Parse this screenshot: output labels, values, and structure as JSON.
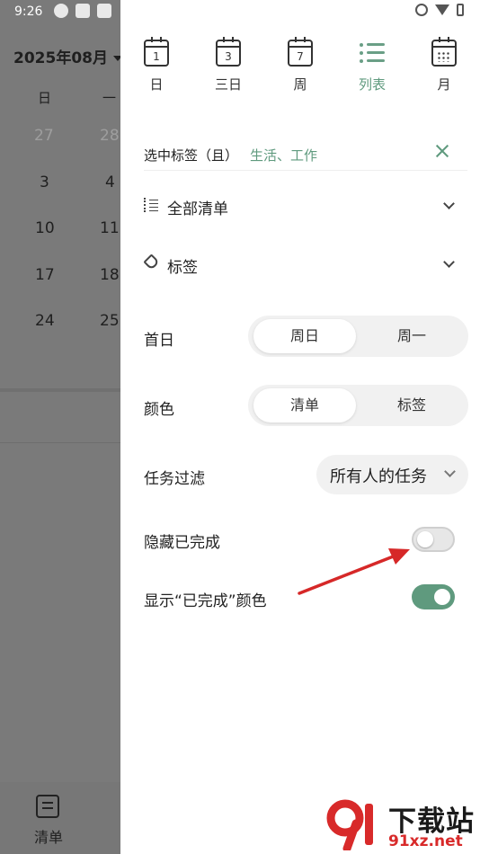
{
  "status_bar": {
    "time": "9:26"
  },
  "background_calendar": {
    "month_title": "2025年08月",
    "weekdays": [
      "日",
      "一"
    ],
    "rows": [
      [
        "27",
        "28"
      ],
      [
        "3",
        "4"
      ],
      [
        "10",
        "11"
      ],
      [
        "17",
        "18"
      ],
      [
        "24",
        "25"
      ]
    ],
    "bottom_tab_label": "清单"
  },
  "drawer": {
    "views": [
      {
        "label": "日",
        "icon": "calendar-day-icon",
        "number": "1",
        "active": false
      },
      {
        "label": "三日",
        "icon": "calendar-3day-icon",
        "number": "3",
        "active": false
      },
      {
        "label": "周",
        "icon": "calendar-week-icon",
        "number": "7",
        "active": false
      },
      {
        "label": "列表",
        "icon": "list-view-icon",
        "active": true
      },
      {
        "label": "月",
        "icon": "calendar-month-icon",
        "active": false
      }
    ],
    "tag_filter": {
      "label": "选中标签（且）",
      "value": "生活、工作"
    },
    "all_lists_label": "全部清单",
    "tags_label": "标签",
    "first_day": {
      "label": "首日",
      "options": [
        "周日",
        "周一"
      ],
      "selected": "周日"
    },
    "color": {
      "label": "颜色",
      "options": [
        "清单",
        "标签"
      ],
      "selected": "清单"
    },
    "task_filter": {
      "label": "任务过滤",
      "value": "所有人的任务"
    },
    "hide_completed": {
      "label": "隐藏已完成",
      "on": false
    },
    "show_completed_color": {
      "label": "显示“已完成”颜色",
      "on": true
    }
  },
  "watermark": {
    "title": "下载站",
    "url": "91xz.net"
  },
  "colors": {
    "accent": "#5f9a7e",
    "annotation_arrow": "#d62828"
  }
}
